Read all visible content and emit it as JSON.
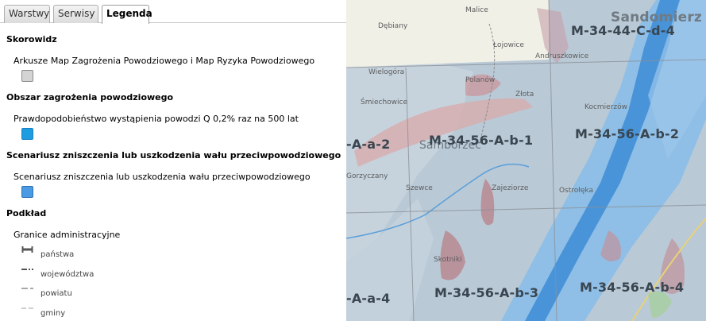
{
  "tabs": [
    {
      "label": "Warstwy"
    },
    {
      "label": "Serwisy"
    },
    {
      "label": "Legenda"
    }
  ],
  "legend": {
    "skorowidz": {
      "heading": "Skorowidz",
      "item": "Arkusze Map Zagrożenia Powodziowego i Map Ryzyka Powodziowego",
      "color": "#d4d4d4"
    },
    "obszar": {
      "heading": "Obszar zagrożenia powodziowego",
      "item": "Prawdopodobieństwo wystąpienia powodzi Q 0,2%  raz na 500 lat",
      "color": "#1e9ce0"
    },
    "scenariusz": {
      "heading": "Scenariusz zniszczenia lub uszkodzenia wału przeciwpowodziowego",
      "item": "Scenariusz zniszczenia lub uszkodzenia wału przeciwpowodziowego",
      "color": "#4a9be3"
    },
    "podklad": {
      "heading": "Podkład",
      "item": "Granice administracyjne",
      "levels": [
        "państwa",
        "województwa",
        "powiatu",
        "gminy"
      ]
    }
  },
  "map": {
    "sheets": [
      "Sandomierz",
      "M-34-44-C-d-4",
      "-A-a-2",
      "M-34-56-A-b-1",
      "M-34-56-A-b-2",
      "-A-a-4",
      "M-34-56-A-b-3",
      "M-34-56-A-b-4"
    ],
    "places": [
      "Malice",
      "Dębiany",
      "Łojowice",
      "Andruszkowice",
      "Wielogóra",
      "Polanów",
      "Śmiechowice",
      "Złota",
      "Kocmierzów",
      "Samborzec",
      "Gorzyczany",
      "Szewce",
      "Zajeziorze",
      "Ostrołęka",
      "Skotniki"
    ]
  }
}
